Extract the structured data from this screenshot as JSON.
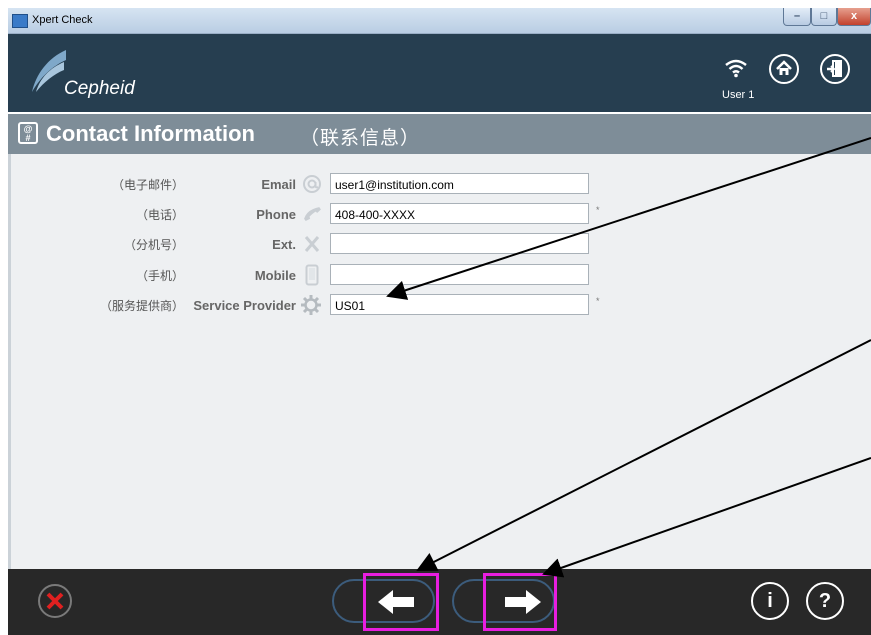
{
  "window": {
    "title": "Xpert Check",
    "minimize": "–",
    "maximize": "□",
    "close": "x"
  },
  "header": {
    "logo_text": "Cepheid",
    "user": "User 1",
    "wifi_icon": "wifi-icon",
    "home_icon": "home-icon",
    "exit_icon": "exit-icon",
    "bg_color": "#263e50"
  },
  "page": {
    "title": "Contact Information",
    "subtitle": "（联系信息）",
    "icon": "contact-card-icon",
    "title_bar_color": "#7e8d98"
  },
  "form": {
    "fields": [
      {
        "cn": "（电子邮件）",
        "label": "Email",
        "icon": "at-sign-icon",
        "value": "user1@institution.com",
        "required": false
      },
      {
        "cn": "（电话）",
        "label": "Phone",
        "icon": "phone-icon",
        "value": "408-400-XXXX",
        "required": true
      },
      {
        "cn": "（分机号）",
        "label": "Ext.",
        "icon": "close-x-icon",
        "value": "",
        "required": false
      },
      {
        "cn": "（手机）",
        "label": "Mobile",
        "icon": "mobile-phone-icon",
        "value": "",
        "required": false
      },
      {
        "cn": "（服务提供商）",
        "label": "Service Provider",
        "icon": "gear-icon",
        "value": "US01",
        "required": true
      }
    ],
    "required_mark": "*"
  },
  "footer": {
    "cancel_icon": "cancel-x-icon",
    "back_icon": "arrow-left-icon",
    "next_icon": "arrow-right-icon",
    "info_label": "i",
    "help_label": "?",
    "highlight_color": "#e81ee0"
  }
}
